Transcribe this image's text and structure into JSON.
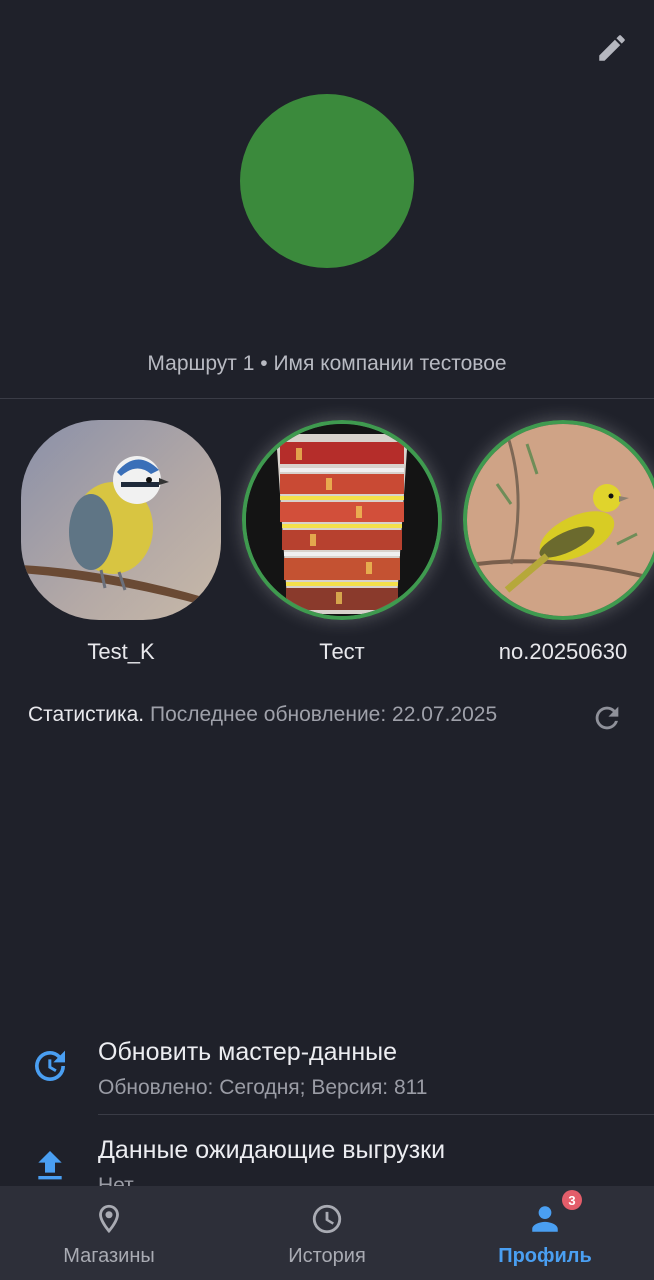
{
  "header": {
    "edit_icon": "pencil-icon"
  },
  "profile": {
    "avatar_color": "#3b8a3c",
    "subtitle": "Маршрут 1 • Имя компании тестовое"
  },
  "profiles": [
    {
      "label": "Test_K",
      "image": "blue-tit-bird-photo",
      "selected": false
    },
    {
      "label": "Тест",
      "image": "store-shelf-photo",
      "selected": true
    },
    {
      "label": "no.20250630",
      "image": "yellow-canary-bird-photo",
      "selected": true
    }
  ],
  "stats": {
    "lead": "Статистика.",
    "rest": " Последнее обновление: 22.07.2025",
    "refresh_icon": "refresh-icon"
  },
  "settings": [
    {
      "icon": "history-refresh-icon",
      "title": "Обновить мастер-данные",
      "subtitle": "Обновлено: Сегодня; Версия: 811"
    },
    {
      "icon": "upload-icon",
      "title": "Данные ожидающие выгрузки",
      "subtitle": "Нет"
    }
  ],
  "nav": {
    "items": [
      {
        "label": "Магазины",
        "icon": "map-pin-icon",
        "active": false
      },
      {
        "label": "История",
        "icon": "clock-icon",
        "active": false
      },
      {
        "label": "Профиль",
        "icon": "person-icon",
        "active": true
      }
    ],
    "badge": "3",
    "accent": "#4a9ff2",
    "badge_color": "#e35d6a"
  }
}
